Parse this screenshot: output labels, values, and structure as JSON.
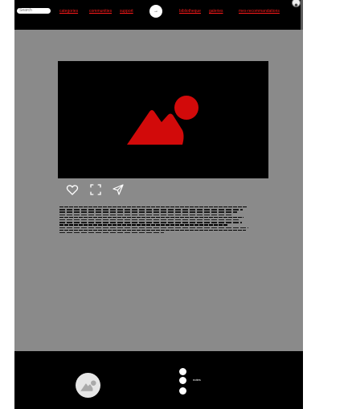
{
  "header": {
    "search": {
      "value": "",
      "placeholder": "Search"
    },
    "nav": {
      "left": [
        "categories",
        "communities",
        "support"
      ],
      "right": [
        "bibliotheque",
        "galeries",
        "mes-recommandations"
      ]
    },
    "home_glyph": "→"
  },
  "main": {
    "image_placeholder_icon": "image-placeholder-icon",
    "actions": [
      "heart-icon",
      "fullscreen-icon",
      "send-icon"
    ],
    "body_text": ""
  },
  "footer": {
    "label": "notes"
  },
  "colors": {
    "page_background": "#8a8a8a",
    "header_background": "#000000",
    "footer_background": "#000000",
    "accent_red": "#d20a0a",
    "link_red": "#ff1a1a"
  }
}
